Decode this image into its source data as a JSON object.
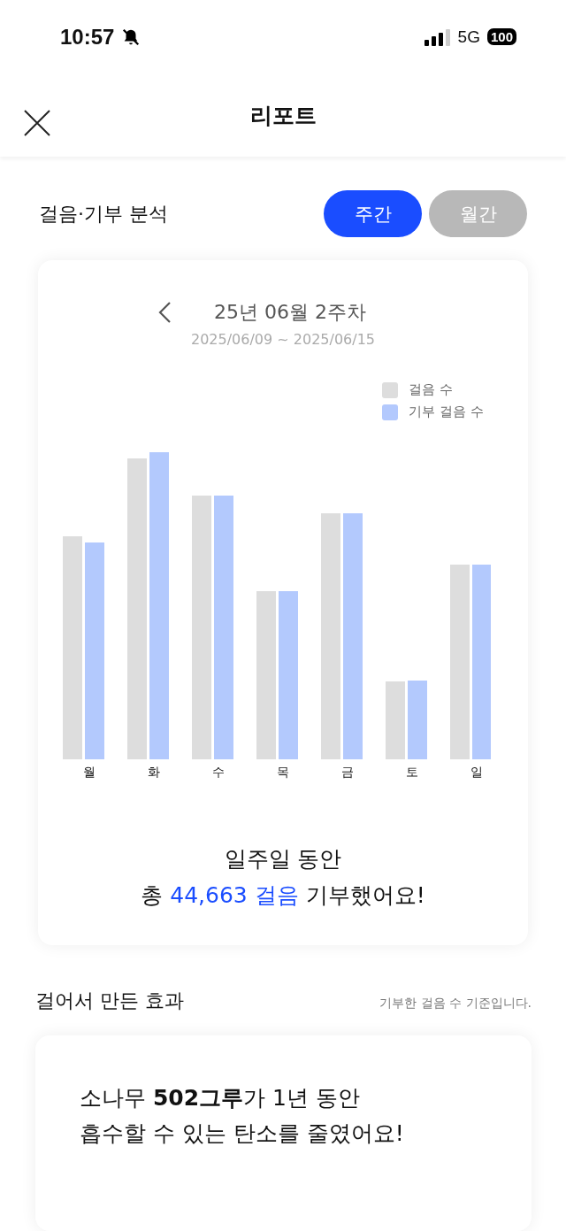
{
  "status_bar": {
    "time": "10:57",
    "network": "5G",
    "battery": "100"
  },
  "header": {
    "title": "리포트"
  },
  "analysis": {
    "title": "걸음·기부 분석",
    "tabs": [
      {
        "label": "주간",
        "selected": true
      },
      {
        "label": "월간",
        "selected": false
      }
    ],
    "week": {
      "title": "25년 06월 2주차",
      "range": "2025/06/09 ~ 2025/06/15"
    },
    "legend": [
      {
        "label": "걸음 수",
        "color": "#dddddd"
      },
      {
        "label": "기부 걸음 수",
        "color": "#b3c9fd"
      }
    ],
    "days": [
      "월",
      "화",
      "수",
      "목",
      "금",
      "토",
      "일"
    ],
    "summary_line1": "일주일 동안",
    "summary_prefix": "총",
    "summary_highlight": "44,663 걸음",
    "summary_suffix": "기부했어요!"
  },
  "effect": {
    "title": "걸어서 만든 효과",
    "note": "기부한 걸음 수 기준입니다.",
    "line1": "소나무 **502그루**가 1년 동안",
    "line2": "흡수할 수 있는 탄소를 줄였어요!"
  }
}
